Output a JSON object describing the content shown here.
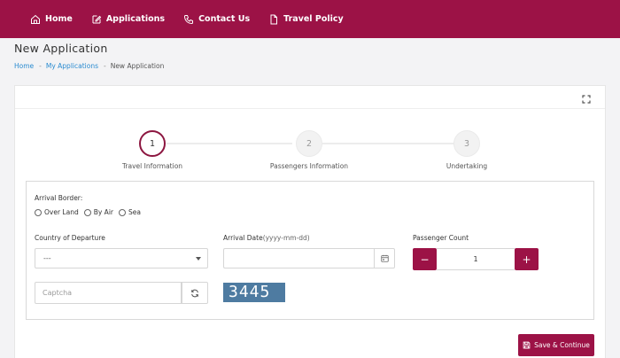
{
  "nav": {
    "items": [
      {
        "label": "Home",
        "icon": "home-icon"
      },
      {
        "label": "Applications",
        "icon": "edit-icon"
      },
      {
        "label": "Contact Us",
        "icon": "phone-icon"
      },
      {
        "label": "Travel Policy",
        "icon": "document-icon"
      }
    ]
  },
  "page": {
    "title": "New Application",
    "breadcrumb": {
      "home": "Home",
      "applications": "My Applications",
      "current": "New Application",
      "separator": "-"
    }
  },
  "stepper": {
    "steps": [
      {
        "number": "1",
        "label": "Travel Information",
        "state": "active"
      },
      {
        "number": "2",
        "label": "Passengers Information",
        "state": "inactive"
      },
      {
        "number": "3",
        "label": "Undertaking",
        "state": "inactive"
      }
    ]
  },
  "form": {
    "arrival_border_label": "Arrival Border:",
    "arrival_border_options": [
      "Over Land",
      "By Air",
      "Sea"
    ],
    "country_label": "Country of Departure",
    "country_value": "---",
    "arrival_date_label": "Arrival Date",
    "arrival_date_hint": "(yyyy-mm-dd)",
    "arrival_date_value": "",
    "passenger_count_label": "Passenger Count",
    "passenger_count_value": "1",
    "minus_label": "−",
    "plus_label": "+",
    "captcha_placeholder": "Captcha",
    "captcha_code": "3445"
  },
  "actions": {
    "save_label": "Save & Continue"
  },
  "colors": {
    "brand": "#9c1246",
    "captcha_bg": "#4e7ba1",
    "link": "#2a8bd0"
  }
}
